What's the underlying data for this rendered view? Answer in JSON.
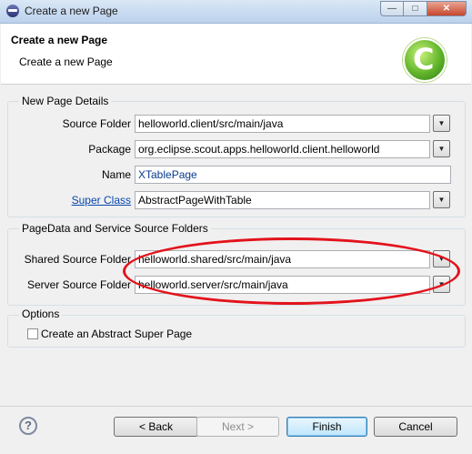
{
  "window": {
    "title": "Create a new Page"
  },
  "header": {
    "title": "Create a new Page",
    "subtitle": "Create a new Page",
    "logo_letter": "C"
  },
  "details": {
    "legend": "New Page Details",
    "source_folder_label": "Source Folder",
    "source_folder_value": "helloworld.client/src/main/java",
    "package_label": "Package",
    "package_value": "org.eclipse.scout.apps.helloworld.client.helloworld",
    "name_label": "Name",
    "name_value": "XTablePage",
    "super_class_label": "Super Class",
    "super_class_value": "AbstractPageWithTable"
  },
  "pagedata": {
    "legend": "PageData and Service Source Folders",
    "shared_label": "Shared Source Folder",
    "shared_value": "helloworld.shared/src/main/java",
    "server_label": "Server Source Folder",
    "server_value": "helloworld.server/src/main/java"
  },
  "options": {
    "legend": "Options",
    "abstract_label": "Create an Abstract Super Page",
    "abstract_checked": false
  },
  "footer": {
    "help_symbol": "?",
    "back_label": "< Back",
    "next_label": "Next >",
    "finish_label": "Finish",
    "cancel_label": "Cancel"
  },
  "icons": {
    "dropdown": "chevron-down-icon",
    "help": "help-icon",
    "logo": "scout-logo-icon"
  },
  "colors": {
    "annotation": "#e3121b",
    "link": "#0645ad",
    "logo_green": "#61b52a"
  }
}
